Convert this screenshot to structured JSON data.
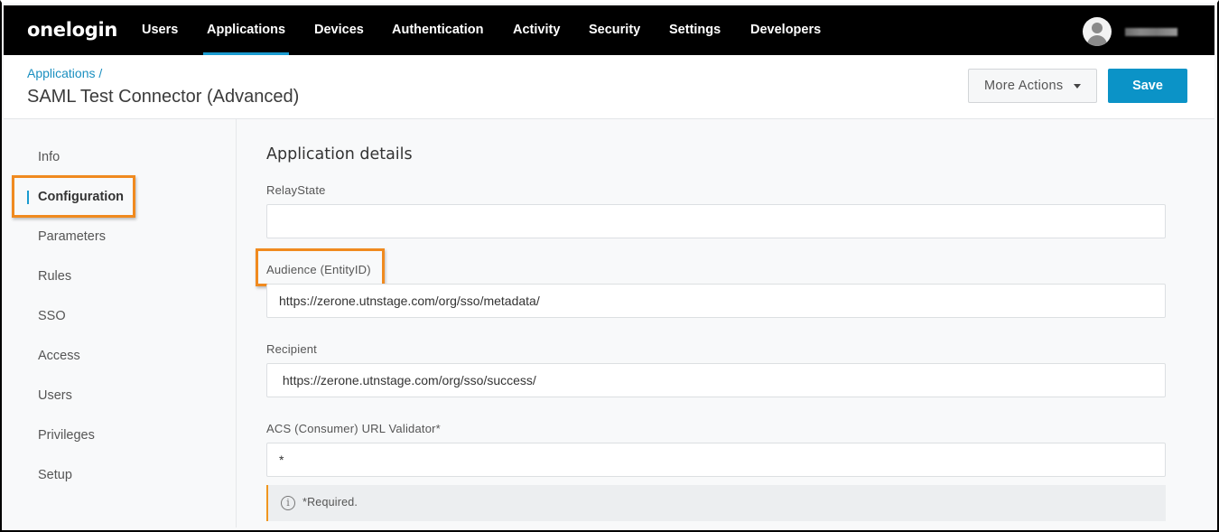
{
  "nav": {
    "logo": "onelogin",
    "items": [
      {
        "label": "Users",
        "active": false
      },
      {
        "label": "Applications",
        "active": true
      },
      {
        "label": "Devices",
        "active": false
      },
      {
        "label": "Authentication",
        "active": false
      },
      {
        "label": "Activity",
        "active": false
      },
      {
        "label": "Security",
        "active": false
      },
      {
        "label": "Settings",
        "active": false
      },
      {
        "label": "Developers",
        "active": false
      }
    ],
    "avatar_icon": "user-avatar-icon"
  },
  "header": {
    "breadcrumb": "Applications /",
    "title": "SAML Test Connector (Advanced)",
    "more_actions_label": "More Actions",
    "save_label": "Save"
  },
  "sidebar": {
    "items": [
      {
        "label": "Info",
        "active": false
      },
      {
        "label": "Configuration",
        "active": true
      },
      {
        "label": "Parameters",
        "active": false
      },
      {
        "label": "Rules",
        "active": false
      },
      {
        "label": "SSO",
        "active": false
      },
      {
        "label": "Access",
        "active": false
      },
      {
        "label": "Users",
        "active": false
      },
      {
        "label": "Privileges",
        "active": false
      },
      {
        "label": "Setup",
        "active": false
      }
    ]
  },
  "main": {
    "section_title": "Application details",
    "fields": [
      {
        "label": "RelayState",
        "value": ""
      },
      {
        "label": "Audience (EntityID)",
        "value": "https://zerone.utnstage.com/org/sso/metadata/"
      },
      {
        "label": "Recipient",
        "value": " https://zerone.utnstage.com/org/sso/success/"
      },
      {
        "label": "ACS (Consumer) URL Validator*",
        "value": "*"
      }
    ],
    "notice": {
      "icon": "info-icon",
      "text": "*Required."
    }
  },
  "colors": {
    "nav_bg": "#000000",
    "accent": "#1a9bd0",
    "save_button": "#0b93c7",
    "highlight": "#f08a1f"
  }
}
